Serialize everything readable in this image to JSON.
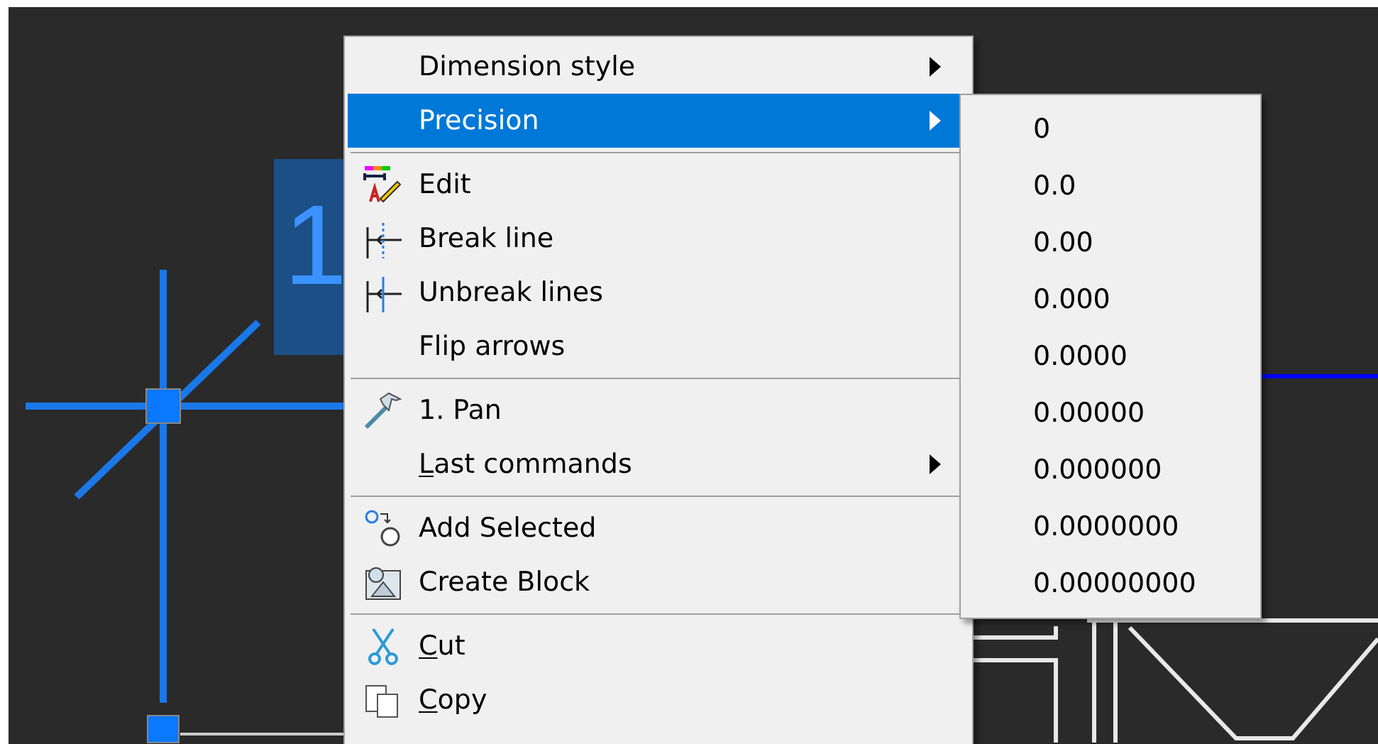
{
  "canvas": {
    "dimension_text": "1"
  },
  "context_menu": {
    "items": [
      {
        "kind": "item",
        "label": "Dimension style",
        "submenu": true,
        "selected": false,
        "underlined_first": false
      },
      {
        "kind": "item",
        "label": "Precision",
        "submenu": true,
        "selected": true,
        "underlined_first": false
      },
      {
        "kind": "separator"
      },
      {
        "kind": "item",
        "label": "Edit",
        "submenu": false,
        "selected": false,
        "underlined_first": false
      },
      {
        "kind": "item",
        "label": "Break line",
        "submenu": false,
        "selected": false,
        "underlined_first": false
      },
      {
        "kind": "item",
        "label": "Unbreak lines",
        "submenu": false,
        "selected": false,
        "underlined_first": false
      },
      {
        "kind": "item",
        "label": "Flip arrows",
        "submenu": false,
        "selected": false,
        "underlined_first": false
      },
      {
        "kind": "separator"
      },
      {
        "kind": "item",
        "label": "1. Pan",
        "submenu": false,
        "selected": false,
        "underlined_first": false
      },
      {
        "kind": "item",
        "label": "Last commands",
        "submenu": true,
        "selected": false,
        "underlined_first": true
      },
      {
        "kind": "separator"
      },
      {
        "kind": "item",
        "label": "Add Selected",
        "submenu": false,
        "selected": false,
        "underlined_first": false
      },
      {
        "kind": "item",
        "label": "Create Block",
        "submenu": false,
        "selected": false,
        "underlined_first": false
      },
      {
        "kind": "separator"
      },
      {
        "kind": "item",
        "label": "Cut",
        "submenu": false,
        "selected": false,
        "underlined_first": true
      },
      {
        "kind": "item",
        "label": "Copy",
        "submenu": false,
        "selected": false,
        "underlined_first": true
      }
    ]
  },
  "precision_submenu": {
    "items": [
      {
        "label": "0",
        "selected": false
      },
      {
        "label": "0.0",
        "selected": false
      },
      {
        "label": "0.00",
        "selected": false
      },
      {
        "label": "0.000",
        "selected": false
      },
      {
        "label": "0.0000",
        "selected": false
      },
      {
        "label": "0.00000",
        "selected": false
      },
      {
        "label": "0.000000",
        "selected": false
      },
      {
        "label": "0.0000000",
        "selected": false
      },
      {
        "label": "0.00000000",
        "selected": false
      }
    ]
  }
}
